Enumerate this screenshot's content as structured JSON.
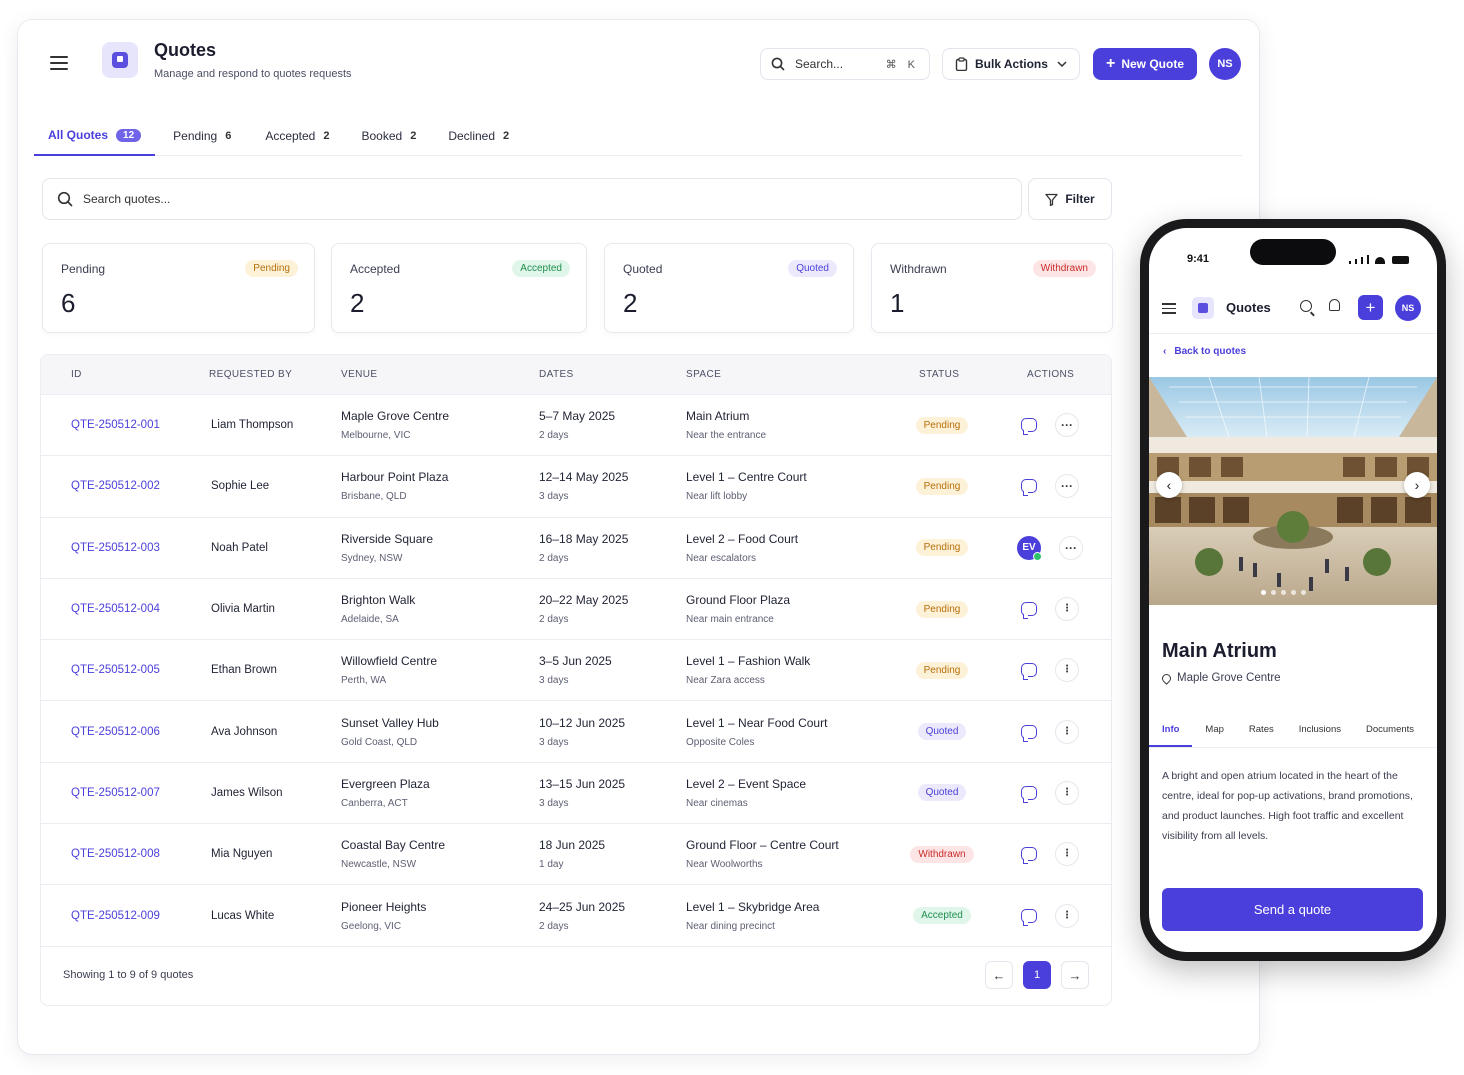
{
  "header": {
    "title": "Quotes",
    "subtitle": "Manage and respond to quotes requests",
    "search_placeholder": "Search...",
    "search_shortcut": "⌘ K",
    "bulk_actions_label": "Bulk Actions",
    "new_quote_label": "New Quote",
    "user_initials": "NS"
  },
  "tabs": [
    {
      "label": "All Quotes",
      "count": "12"
    },
    {
      "label": "Pending",
      "count": "6"
    },
    {
      "label": "Accepted",
      "count": "2"
    },
    {
      "label": "Booked",
      "count": "2"
    },
    {
      "label": "Declined",
      "count": "2"
    }
  ],
  "filters": {
    "search_placeholder": "Search quotes...",
    "filter_label": "Filter"
  },
  "stats": [
    {
      "label": "Pending",
      "value": "6",
      "badge": "Pending"
    },
    {
      "label": "Accepted",
      "value": "2",
      "badge": "Accepted"
    },
    {
      "label": "Quoted",
      "value": "2",
      "badge": "Quoted"
    },
    {
      "label": "Withdrawn",
      "value": "1",
      "badge": "Withdrawn"
    }
  ],
  "table": {
    "columns": [
      "ID",
      "REQUESTED BY",
      "VENUE",
      "DATES",
      "SPACE",
      "STATUS",
      "ACTIONS"
    ],
    "rows": [
      {
        "id": "QTE-250512-001",
        "requested_by": "Liam Thompson",
        "venue": "Maple Grove Centre",
        "location": "Melbourne, VIC",
        "dates": "5–7 May 2025",
        "days": "2 days",
        "space": "Main Atrium",
        "space_note": "Near the entrance",
        "status": "Pending"
      },
      {
        "id": "QTE-250512-002",
        "requested_by": "Sophie Lee",
        "venue": "Harbour Point Plaza",
        "location": "Brisbane, QLD",
        "dates": "12–14 May 2025",
        "days": "3 days",
        "space": "Level 1 – Centre Court",
        "space_note": "Near lift lobby",
        "status": "Pending"
      },
      {
        "id": "QTE-250512-003",
        "requested_by": "Noah Patel",
        "venue": "Riverside Square",
        "location": "Sydney, NSW",
        "dates": "16–18 May 2025",
        "days": "2 days",
        "space": "Level 2 – Food Court",
        "space_note": "Near escalators",
        "status": "Pending",
        "assignee": "EV"
      },
      {
        "id": "QTE-250512-004",
        "requested_by": "Olivia Martin",
        "venue": "Brighton Walk",
        "location": "Adelaide, SA",
        "dates": "20–22 May 2025",
        "days": "2 days",
        "space": "Ground Floor Plaza",
        "space_note": "Near main entrance",
        "status": "Pending"
      },
      {
        "id": "QTE-250512-005",
        "requested_by": "Ethan Brown",
        "venue": "Willowfield Centre",
        "location": "Perth, WA",
        "dates": "3–5 Jun 2025",
        "days": "3 days",
        "space": "Level 1 – Fashion Walk",
        "space_note": "Near Zara access",
        "status": "Pending"
      },
      {
        "id": "QTE-250512-006",
        "requested_by": "Ava Johnson",
        "venue": "Sunset Valley Hub",
        "location": "Gold Coast, QLD",
        "dates": "10–12 Jun 2025",
        "days": "3 days",
        "space": "Level 1 – Near Food Court",
        "space_note": "Opposite Coles",
        "status": "Quoted"
      },
      {
        "id": "QTE-250512-007",
        "requested_by": "James Wilson",
        "venue": "Evergreen Plaza",
        "location": "Canberra, ACT",
        "dates": "13–15 Jun 2025",
        "days": "3 days",
        "space": "Level 2 – Event Space",
        "space_note": "Near cinemas",
        "status": "Quoted"
      },
      {
        "id": "QTE-250512-008",
        "requested_by": "Mia Nguyen",
        "venue": "Coastal Bay Centre",
        "location": "Newcastle, NSW",
        "dates": "18 Jun 2025",
        "days": "1 day",
        "space": "Ground Floor – Centre Court",
        "space_note": "Near Woolworths",
        "status": "Withdrawn"
      },
      {
        "id": "QTE-250512-009",
        "requested_by": "Lucas White",
        "venue": "Pioneer Heights",
        "location": "Geelong, VIC",
        "dates": "24–25 Jun 2025",
        "days": "2 days",
        "space": "Level 1 – Skybridge Area",
        "space_note": "Near dining precinct",
        "status": "Accepted"
      }
    ],
    "footer": "Showing 1 to 9 of 9 quotes",
    "current_page": "1"
  },
  "mobile": {
    "time": "9:41",
    "title": "Quotes",
    "user_initials": "NS",
    "back_label": "Back to quotes",
    "space_title": "Main Atrium",
    "venue": "Maple Grove Centre",
    "tabs": [
      "Info",
      "Map",
      "Rates",
      "Inclusions",
      "Documents"
    ],
    "description": "A bright and open atrium located in the heart of the centre, ideal for pop-up activations, brand promotions, and product launches. High foot traffic and excellent visibility from all levels.",
    "send_label": "Send a quote"
  },
  "colors": {
    "accent": "#4b3fdb",
    "pending": "#b5700a",
    "accepted": "#1f8f4e",
    "quoted": "#4b3fdb",
    "withdrawn": "#cc2b2b"
  }
}
